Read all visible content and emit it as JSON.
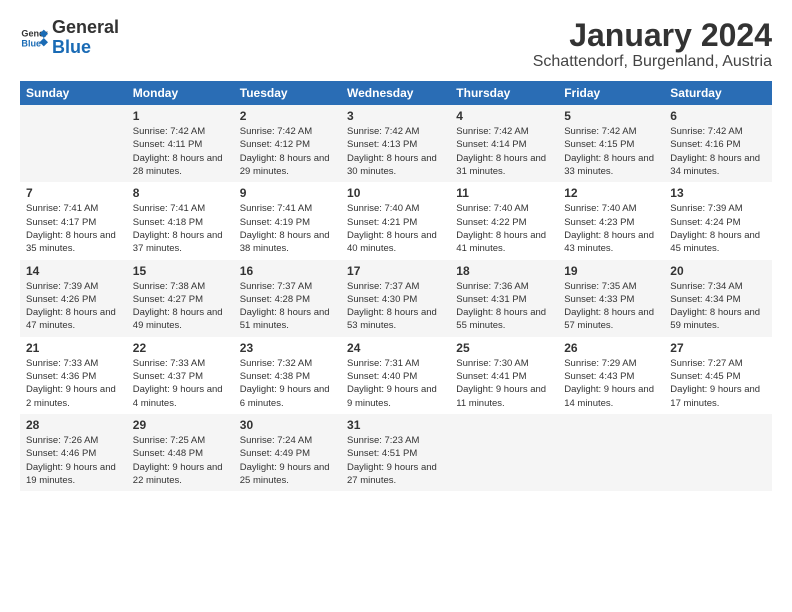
{
  "header": {
    "logo_general": "General",
    "logo_blue": "Blue",
    "title": "January 2024",
    "location": "Schattendorf, Burgenland, Austria"
  },
  "columns": [
    "Sunday",
    "Monday",
    "Tuesday",
    "Wednesday",
    "Thursday",
    "Friday",
    "Saturday"
  ],
  "weeks": [
    [
      {
        "day": "",
        "sunrise": "",
        "sunset": "",
        "daylight": ""
      },
      {
        "day": "1",
        "sunrise": "Sunrise: 7:42 AM",
        "sunset": "Sunset: 4:11 PM",
        "daylight": "Daylight: 8 hours and 28 minutes."
      },
      {
        "day": "2",
        "sunrise": "Sunrise: 7:42 AM",
        "sunset": "Sunset: 4:12 PM",
        "daylight": "Daylight: 8 hours and 29 minutes."
      },
      {
        "day": "3",
        "sunrise": "Sunrise: 7:42 AM",
        "sunset": "Sunset: 4:13 PM",
        "daylight": "Daylight: 8 hours and 30 minutes."
      },
      {
        "day": "4",
        "sunrise": "Sunrise: 7:42 AM",
        "sunset": "Sunset: 4:14 PM",
        "daylight": "Daylight: 8 hours and 31 minutes."
      },
      {
        "day": "5",
        "sunrise": "Sunrise: 7:42 AM",
        "sunset": "Sunset: 4:15 PM",
        "daylight": "Daylight: 8 hours and 33 minutes."
      },
      {
        "day": "6",
        "sunrise": "Sunrise: 7:42 AM",
        "sunset": "Sunset: 4:16 PM",
        "daylight": "Daylight: 8 hours and 34 minutes."
      }
    ],
    [
      {
        "day": "7",
        "sunrise": "Sunrise: 7:41 AM",
        "sunset": "Sunset: 4:17 PM",
        "daylight": "Daylight: 8 hours and 35 minutes."
      },
      {
        "day": "8",
        "sunrise": "Sunrise: 7:41 AM",
        "sunset": "Sunset: 4:18 PM",
        "daylight": "Daylight: 8 hours and 37 minutes."
      },
      {
        "day": "9",
        "sunrise": "Sunrise: 7:41 AM",
        "sunset": "Sunset: 4:19 PM",
        "daylight": "Daylight: 8 hours and 38 minutes."
      },
      {
        "day": "10",
        "sunrise": "Sunrise: 7:40 AM",
        "sunset": "Sunset: 4:21 PM",
        "daylight": "Daylight: 8 hours and 40 minutes."
      },
      {
        "day": "11",
        "sunrise": "Sunrise: 7:40 AM",
        "sunset": "Sunset: 4:22 PM",
        "daylight": "Daylight: 8 hours and 41 minutes."
      },
      {
        "day": "12",
        "sunrise": "Sunrise: 7:40 AM",
        "sunset": "Sunset: 4:23 PM",
        "daylight": "Daylight: 8 hours and 43 minutes."
      },
      {
        "day": "13",
        "sunrise": "Sunrise: 7:39 AM",
        "sunset": "Sunset: 4:24 PM",
        "daylight": "Daylight: 8 hours and 45 minutes."
      }
    ],
    [
      {
        "day": "14",
        "sunrise": "Sunrise: 7:39 AM",
        "sunset": "Sunset: 4:26 PM",
        "daylight": "Daylight: 8 hours and 47 minutes."
      },
      {
        "day": "15",
        "sunrise": "Sunrise: 7:38 AM",
        "sunset": "Sunset: 4:27 PM",
        "daylight": "Daylight: 8 hours and 49 minutes."
      },
      {
        "day": "16",
        "sunrise": "Sunrise: 7:37 AM",
        "sunset": "Sunset: 4:28 PM",
        "daylight": "Daylight: 8 hours and 51 minutes."
      },
      {
        "day": "17",
        "sunrise": "Sunrise: 7:37 AM",
        "sunset": "Sunset: 4:30 PM",
        "daylight": "Daylight: 8 hours and 53 minutes."
      },
      {
        "day": "18",
        "sunrise": "Sunrise: 7:36 AM",
        "sunset": "Sunset: 4:31 PM",
        "daylight": "Daylight: 8 hours and 55 minutes."
      },
      {
        "day": "19",
        "sunrise": "Sunrise: 7:35 AM",
        "sunset": "Sunset: 4:33 PM",
        "daylight": "Daylight: 8 hours and 57 minutes."
      },
      {
        "day": "20",
        "sunrise": "Sunrise: 7:34 AM",
        "sunset": "Sunset: 4:34 PM",
        "daylight": "Daylight: 8 hours and 59 minutes."
      }
    ],
    [
      {
        "day": "21",
        "sunrise": "Sunrise: 7:33 AM",
        "sunset": "Sunset: 4:36 PM",
        "daylight": "Daylight: 9 hours and 2 minutes."
      },
      {
        "day": "22",
        "sunrise": "Sunrise: 7:33 AM",
        "sunset": "Sunset: 4:37 PM",
        "daylight": "Daylight: 9 hours and 4 minutes."
      },
      {
        "day": "23",
        "sunrise": "Sunrise: 7:32 AM",
        "sunset": "Sunset: 4:38 PM",
        "daylight": "Daylight: 9 hours and 6 minutes."
      },
      {
        "day": "24",
        "sunrise": "Sunrise: 7:31 AM",
        "sunset": "Sunset: 4:40 PM",
        "daylight": "Daylight: 9 hours and 9 minutes."
      },
      {
        "day": "25",
        "sunrise": "Sunrise: 7:30 AM",
        "sunset": "Sunset: 4:41 PM",
        "daylight": "Daylight: 9 hours and 11 minutes."
      },
      {
        "day": "26",
        "sunrise": "Sunrise: 7:29 AM",
        "sunset": "Sunset: 4:43 PM",
        "daylight": "Daylight: 9 hours and 14 minutes."
      },
      {
        "day": "27",
        "sunrise": "Sunrise: 7:27 AM",
        "sunset": "Sunset: 4:45 PM",
        "daylight": "Daylight: 9 hours and 17 minutes."
      }
    ],
    [
      {
        "day": "28",
        "sunrise": "Sunrise: 7:26 AM",
        "sunset": "Sunset: 4:46 PM",
        "daylight": "Daylight: 9 hours and 19 minutes."
      },
      {
        "day": "29",
        "sunrise": "Sunrise: 7:25 AM",
        "sunset": "Sunset: 4:48 PM",
        "daylight": "Daylight: 9 hours and 22 minutes."
      },
      {
        "day": "30",
        "sunrise": "Sunrise: 7:24 AM",
        "sunset": "Sunset: 4:49 PM",
        "daylight": "Daylight: 9 hours and 25 minutes."
      },
      {
        "day": "31",
        "sunrise": "Sunrise: 7:23 AM",
        "sunset": "Sunset: 4:51 PM",
        "daylight": "Daylight: 9 hours and 27 minutes."
      },
      {
        "day": "",
        "sunrise": "",
        "sunset": "",
        "daylight": ""
      },
      {
        "day": "",
        "sunrise": "",
        "sunset": "",
        "daylight": ""
      },
      {
        "day": "",
        "sunrise": "",
        "sunset": "",
        "daylight": ""
      }
    ]
  ]
}
